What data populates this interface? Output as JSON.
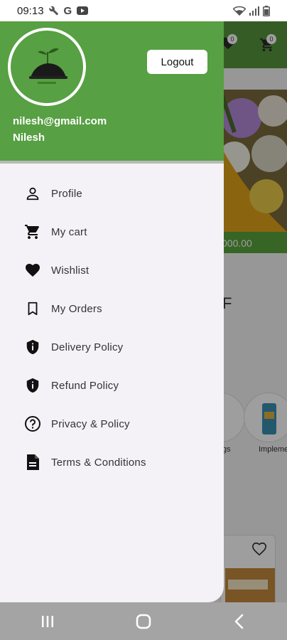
{
  "status_bar": {
    "time": "09:13",
    "left_icons": [
      "wrench-icon",
      "google-icon",
      "youtube-icon"
    ],
    "right_icons": [
      "wifi-icon",
      "signal-icon",
      "battery-icon"
    ]
  },
  "drawer": {
    "header_color": "#57a043",
    "logout_label": "Logout",
    "user_email": "nilesh@gmail.com",
    "user_name": "Nilesh",
    "menu_items": [
      {
        "label": "Profile",
        "icon": "person-icon"
      },
      {
        "label": "My cart",
        "icon": "cart-icon"
      },
      {
        "label": "Wishlist",
        "icon": "heart-icon"
      },
      {
        "label": "My Orders",
        "icon": "bookmark-icon"
      },
      {
        "label": "Delivery Policy",
        "icon": "shield-info-icon"
      },
      {
        "label": "Refund Policy",
        "icon": "shield-info-icon"
      },
      {
        "label": "Privacy & Policy",
        "icon": "help-circle-icon"
      },
      {
        "label": "Terms & Conditions",
        "icon": "document-icon"
      }
    ]
  },
  "background": {
    "cart_count": "0",
    "wishlist_count": "0",
    "price": "000.00",
    "partial_heading": "F",
    "category_labels": [
      "gs",
      "Impleme"
    ]
  },
  "nav_bar": {
    "buttons": [
      "recents-icon",
      "home-icon",
      "back-icon"
    ]
  }
}
